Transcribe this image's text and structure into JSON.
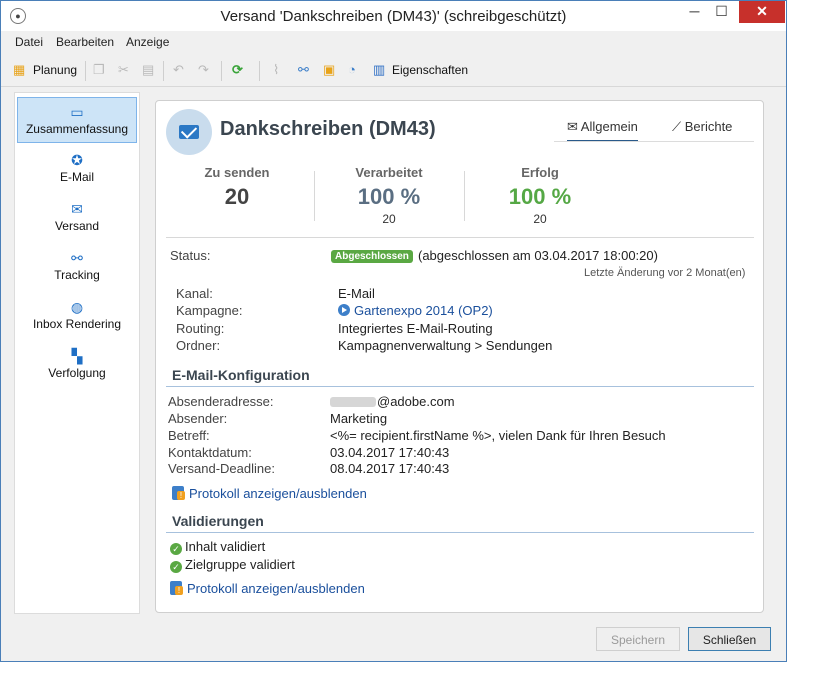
{
  "window": {
    "title": "Versand 'Dankschreiben (DM43)' (schreibgeschützt)",
    "minimize": "─",
    "maximize": "☐",
    "close": "✕"
  },
  "menu": [
    "Datei",
    "Bearbeiten",
    "Anzeige"
  ],
  "toolbar": {
    "planung": "Planung",
    "eigenschaften": "Eigenschaften"
  },
  "sidebar": {
    "items": [
      {
        "label": "Zusammenfassung",
        "icon": "summary-icon",
        "active": true
      },
      {
        "label": "E-Mail",
        "icon": "email-icon"
      },
      {
        "label": "Versand",
        "icon": "delivery-icon"
      },
      {
        "label": "Tracking",
        "icon": "tracking-icon"
      },
      {
        "label": "Inbox Rendering",
        "icon": "inbox-rendering-icon"
      },
      {
        "label": "Verfolgung",
        "icon": "audit-icon"
      }
    ]
  },
  "panel": {
    "title": "Dankschreiben (DM43)",
    "tabs": [
      "Allgemein",
      "Berichte"
    ],
    "stats": [
      {
        "label": "Zu senden",
        "value": "20",
        "sub": "",
        "color": "#444444"
      },
      {
        "label": "Verarbeitet",
        "value": "100 %",
        "sub": "20",
        "color": "#5a6e82"
      },
      {
        "label": "Erfolg",
        "value": "100 %",
        "sub": "20",
        "color": "#55a845"
      }
    ],
    "status": {
      "label": "Status:",
      "badge": "Abgeschlossen",
      "text": "(abgeschlossen am 03.04.2017 18:00:20)",
      "note": "Letzte Änderung vor 2 Monat(en)"
    },
    "info": [
      {
        "label": "Kanal:",
        "value": "E-Mail"
      },
      {
        "label": "Kampagne:",
        "value": "Gartenexpo 2014 (OP2)"
      },
      {
        "label": "Routing:",
        "value": "Integriertes E-Mail-Routing"
      },
      {
        "label": "Ordner:",
        "value": "Kampagnenverwaltung > Sendungen"
      }
    ],
    "email_config": {
      "heading": "E-Mail-Konfiguration",
      "rows": [
        {
          "label": "Absenderadresse:",
          "value": "@adobe.com"
        },
        {
          "label": "Absender:",
          "value": "Marketing"
        },
        {
          "label": "Betreff:",
          "value": "<%= recipient.firstName %>, vielen Dank für Ihren Besuch"
        },
        {
          "label": "Kontaktdatum:",
          "value": "03.04.2017 17:40:43"
        },
        {
          "label": "Versand-Deadline:",
          "value": "08.04.2017 17:40:43"
        }
      ],
      "log_link": "Protokoll anzeigen/ausblenden"
    },
    "validations": {
      "heading": "Validierungen",
      "items": [
        "Inhalt validiert",
        "Zielgruppe validiert"
      ],
      "log_link": "Protokoll anzeigen/ausblenden"
    }
  },
  "buttons": {
    "save": "Speichern",
    "close": "Schließen"
  }
}
